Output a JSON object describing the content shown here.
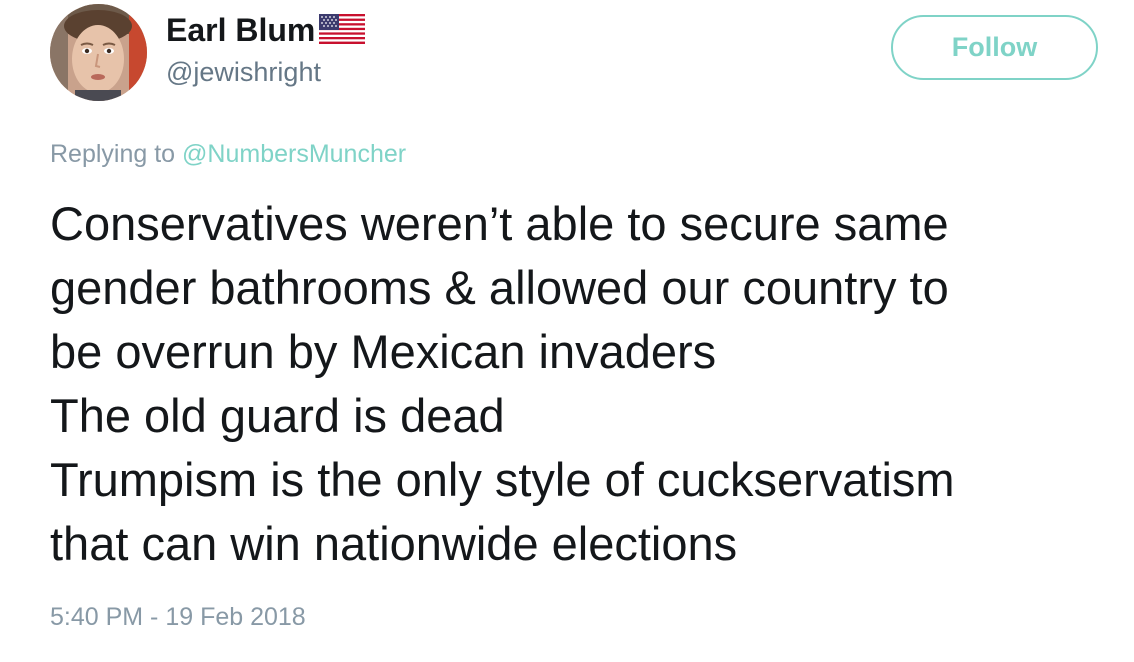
{
  "user": {
    "display_name": "Earl Blum",
    "handle": "@jewishright",
    "name_badge_icon": "us-flag-icon",
    "avatar_icon": "user-avatar"
  },
  "follow_button": {
    "label": "Follow",
    "accent_color": "#7fd3c7"
  },
  "reply": {
    "prefix": "Replying to",
    "mention": "@NumbersMuncher"
  },
  "tweet": {
    "lines": [
      "Conservatives weren’t able to secure same",
      "gender bathrooms & allowed our country to",
      "be overrun by Mexican invaders",
      "The old guard is dead",
      "Trumpism is the only style of cuckservatism",
      "that can win nationwide elections"
    ]
  },
  "timestamp": "5:40 PM - 19 Feb 2018",
  "colors": {
    "text_primary": "#14171a",
    "text_secondary": "#657786",
    "text_muted": "#8899a6",
    "link": "#7fd3c7"
  }
}
